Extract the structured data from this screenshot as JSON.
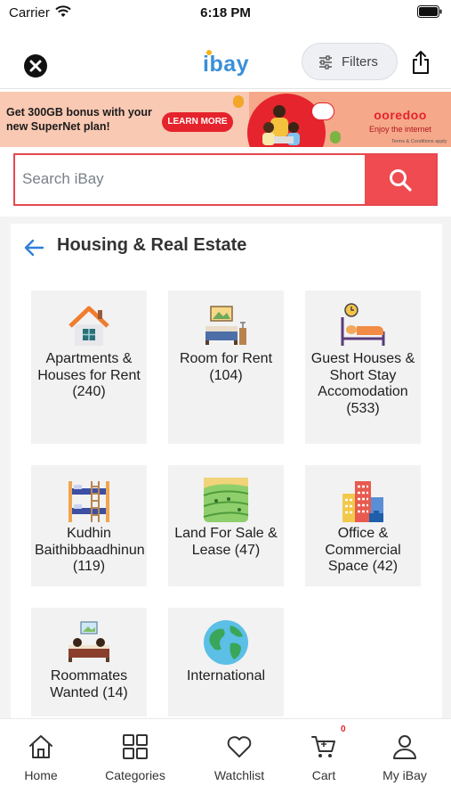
{
  "status_bar": {
    "carrier": "Carrier",
    "time": "6:18 PM"
  },
  "header": {
    "logo": "ibay",
    "filters_label": "Filters"
  },
  "banner": {
    "headline": "Get 300GB bonus with your new SuperNet plan!",
    "cta": "LEARN MORE",
    "brand": "ooredoo",
    "tagline": "Enjoy the internet",
    "terms": "Terms & Conditions apply"
  },
  "search": {
    "placeholder": "Search iBay",
    "value": ""
  },
  "section": {
    "title": "Housing & Real Estate"
  },
  "categories": [
    {
      "label": "Apartments & Houses for Rent (240)",
      "icon": "house-icon"
    },
    {
      "label": "Room for Rent (104)",
      "icon": "bedroom-icon"
    },
    {
      "label": "Guest Houses & Short Stay Accomodation (533)",
      "icon": "hotel-bed-icon"
    },
    {
      "label": "Kudhin Baithibbaadhinun (119)",
      "icon": "bunk-bed-icon"
    },
    {
      "label": "Land For Sale & Lease (47)",
      "icon": "land-field-icon"
    },
    {
      "label": "Office & Commercial Space (42)",
      "icon": "office-building-icon"
    },
    {
      "label": "Roommates Wanted (14)",
      "icon": "roommates-icon"
    },
    {
      "label": "International",
      "icon": "globe-icon"
    }
  ],
  "tabbar": {
    "items": [
      {
        "label": "Home",
        "icon": "home-icon"
      },
      {
        "label": "Categories",
        "icon": "grid-icon"
      },
      {
        "label": "Watchlist",
        "icon": "heart-icon"
      },
      {
        "label": "Cart",
        "icon": "cart-icon"
      },
      {
        "label": "My iBay",
        "icon": "user-icon"
      }
    ],
    "cart_count": "0"
  },
  "colors": {
    "accent": "#ef4b50",
    "brand_blue": "#3b8fd9",
    "back_arrow": "#2f7fd8"
  }
}
